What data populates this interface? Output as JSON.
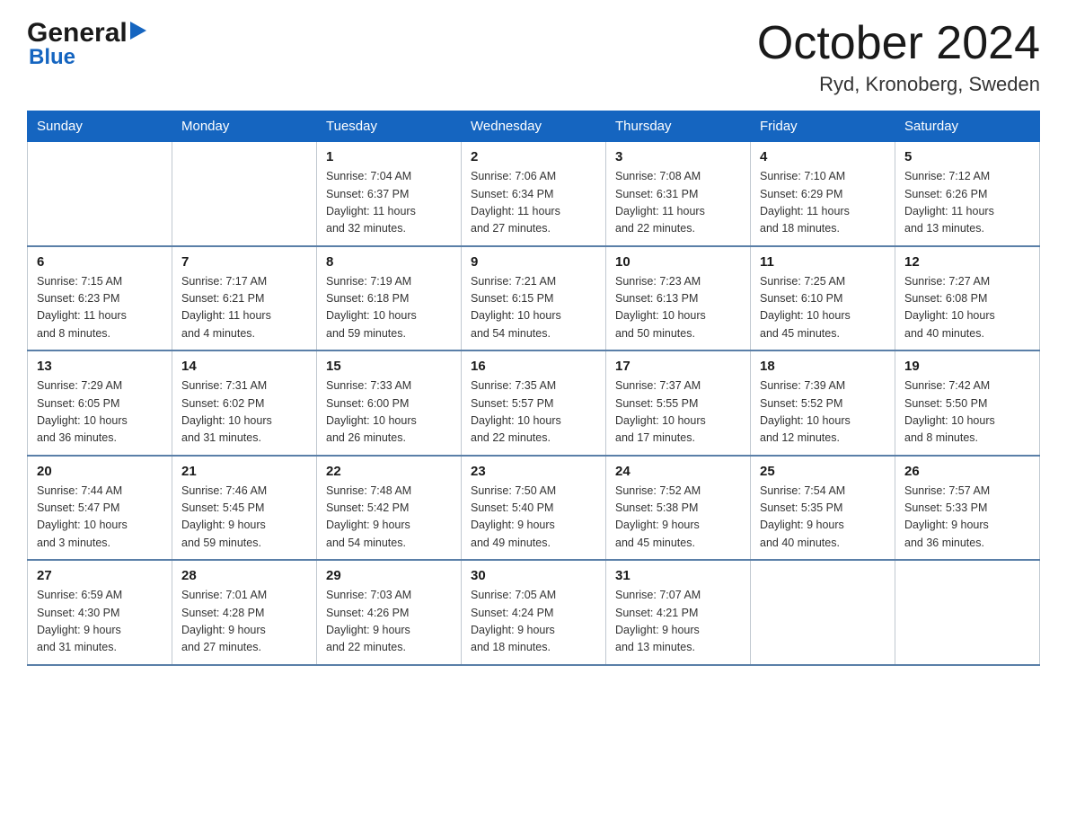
{
  "logo": {
    "general": "General",
    "blue": "Blue",
    "triangle": "▶"
  },
  "title": "October 2024",
  "location": "Ryd, Kronoberg, Sweden",
  "headers": [
    "Sunday",
    "Monday",
    "Tuesday",
    "Wednesday",
    "Thursday",
    "Friday",
    "Saturday"
  ],
  "weeks": [
    [
      {
        "day": "",
        "info": ""
      },
      {
        "day": "",
        "info": ""
      },
      {
        "day": "1",
        "info": "Sunrise: 7:04 AM\nSunset: 6:37 PM\nDaylight: 11 hours\nand 32 minutes."
      },
      {
        "day": "2",
        "info": "Sunrise: 7:06 AM\nSunset: 6:34 PM\nDaylight: 11 hours\nand 27 minutes."
      },
      {
        "day": "3",
        "info": "Sunrise: 7:08 AM\nSunset: 6:31 PM\nDaylight: 11 hours\nand 22 minutes."
      },
      {
        "day": "4",
        "info": "Sunrise: 7:10 AM\nSunset: 6:29 PM\nDaylight: 11 hours\nand 18 minutes."
      },
      {
        "day": "5",
        "info": "Sunrise: 7:12 AM\nSunset: 6:26 PM\nDaylight: 11 hours\nand 13 minutes."
      }
    ],
    [
      {
        "day": "6",
        "info": "Sunrise: 7:15 AM\nSunset: 6:23 PM\nDaylight: 11 hours\nand 8 minutes."
      },
      {
        "day": "7",
        "info": "Sunrise: 7:17 AM\nSunset: 6:21 PM\nDaylight: 11 hours\nand 4 minutes."
      },
      {
        "day": "8",
        "info": "Sunrise: 7:19 AM\nSunset: 6:18 PM\nDaylight: 10 hours\nand 59 minutes."
      },
      {
        "day": "9",
        "info": "Sunrise: 7:21 AM\nSunset: 6:15 PM\nDaylight: 10 hours\nand 54 minutes."
      },
      {
        "day": "10",
        "info": "Sunrise: 7:23 AM\nSunset: 6:13 PM\nDaylight: 10 hours\nand 50 minutes."
      },
      {
        "day": "11",
        "info": "Sunrise: 7:25 AM\nSunset: 6:10 PM\nDaylight: 10 hours\nand 45 minutes."
      },
      {
        "day": "12",
        "info": "Sunrise: 7:27 AM\nSunset: 6:08 PM\nDaylight: 10 hours\nand 40 minutes."
      }
    ],
    [
      {
        "day": "13",
        "info": "Sunrise: 7:29 AM\nSunset: 6:05 PM\nDaylight: 10 hours\nand 36 minutes."
      },
      {
        "day": "14",
        "info": "Sunrise: 7:31 AM\nSunset: 6:02 PM\nDaylight: 10 hours\nand 31 minutes."
      },
      {
        "day": "15",
        "info": "Sunrise: 7:33 AM\nSunset: 6:00 PM\nDaylight: 10 hours\nand 26 minutes."
      },
      {
        "day": "16",
        "info": "Sunrise: 7:35 AM\nSunset: 5:57 PM\nDaylight: 10 hours\nand 22 minutes."
      },
      {
        "day": "17",
        "info": "Sunrise: 7:37 AM\nSunset: 5:55 PM\nDaylight: 10 hours\nand 17 minutes."
      },
      {
        "day": "18",
        "info": "Sunrise: 7:39 AM\nSunset: 5:52 PM\nDaylight: 10 hours\nand 12 minutes."
      },
      {
        "day": "19",
        "info": "Sunrise: 7:42 AM\nSunset: 5:50 PM\nDaylight: 10 hours\nand 8 minutes."
      }
    ],
    [
      {
        "day": "20",
        "info": "Sunrise: 7:44 AM\nSunset: 5:47 PM\nDaylight: 10 hours\nand 3 minutes."
      },
      {
        "day": "21",
        "info": "Sunrise: 7:46 AM\nSunset: 5:45 PM\nDaylight: 9 hours\nand 59 minutes."
      },
      {
        "day": "22",
        "info": "Sunrise: 7:48 AM\nSunset: 5:42 PM\nDaylight: 9 hours\nand 54 minutes."
      },
      {
        "day": "23",
        "info": "Sunrise: 7:50 AM\nSunset: 5:40 PM\nDaylight: 9 hours\nand 49 minutes."
      },
      {
        "day": "24",
        "info": "Sunrise: 7:52 AM\nSunset: 5:38 PM\nDaylight: 9 hours\nand 45 minutes."
      },
      {
        "day": "25",
        "info": "Sunrise: 7:54 AM\nSunset: 5:35 PM\nDaylight: 9 hours\nand 40 minutes."
      },
      {
        "day": "26",
        "info": "Sunrise: 7:57 AM\nSunset: 5:33 PM\nDaylight: 9 hours\nand 36 minutes."
      }
    ],
    [
      {
        "day": "27",
        "info": "Sunrise: 6:59 AM\nSunset: 4:30 PM\nDaylight: 9 hours\nand 31 minutes."
      },
      {
        "day": "28",
        "info": "Sunrise: 7:01 AM\nSunset: 4:28 PM\nDaylight: 9 hours\nand 27 minutes."
      },
      {
        "day": "29",
        "info": "Sunrise: 7:03 AM\nSunset: 4:26 PM\nDaylight: 9 hours\nand 22 minutes."
      },
      {
        "day": "30",
        "info": "Sunrise: 7:05 AM\nSunset: 4:24 PM\nDaylight: 9 hours\nand 18 minutes."
      },
      {
        "day": "31",
        "info": "Sunrise: 7:07 AM\nSunset: 4:21 PM\nDaylight: 9 hours\nand 13 minutes."
      },
      {
        "day": "",
        "info": ""
      },
      {
        "day": "",
        "info": ""
      }
    ]
  ]
}
